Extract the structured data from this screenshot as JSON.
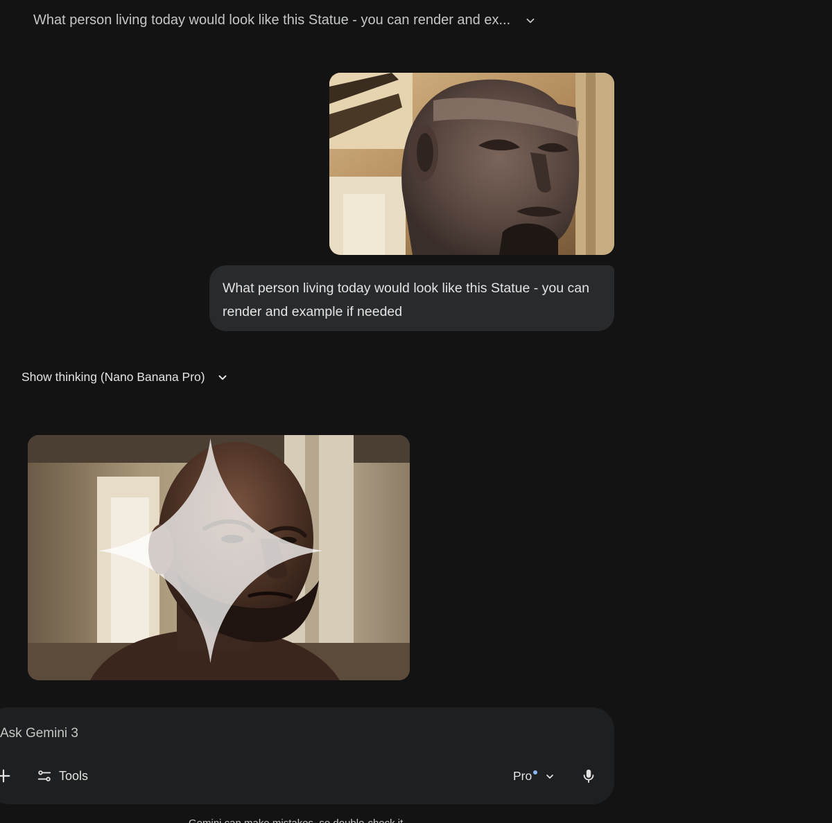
{
  "header": {
    "conversation_title": "What person living today would look like this Statue - you can render and ex..."
  },
  "user_message": {
    "image_alt": "Granite statue head",
    "text": "What person living today would look like this Statue - you can render and example if needed"
  },
  "response": {
    "show_thinking_label": "Show thinking (Nano Banana Pro)",
    "generated_image_alt": "Generated portrait of a bald man"
  },
  "composer": {
    "placeholder": "Ask Gemini 3",
    "tools_label": "Tools",
    "model_label": "Pro"
  },
  "footer": {
    "disclaimer": "Gemini can make mistakes, so double-check it"
  },
  "colors": {
    "background": "#131314",
    "bubble": "#282a2c",
    "composer": "#1e1f20",
    "accent_dot": "#8ab4f8"
  }
}
